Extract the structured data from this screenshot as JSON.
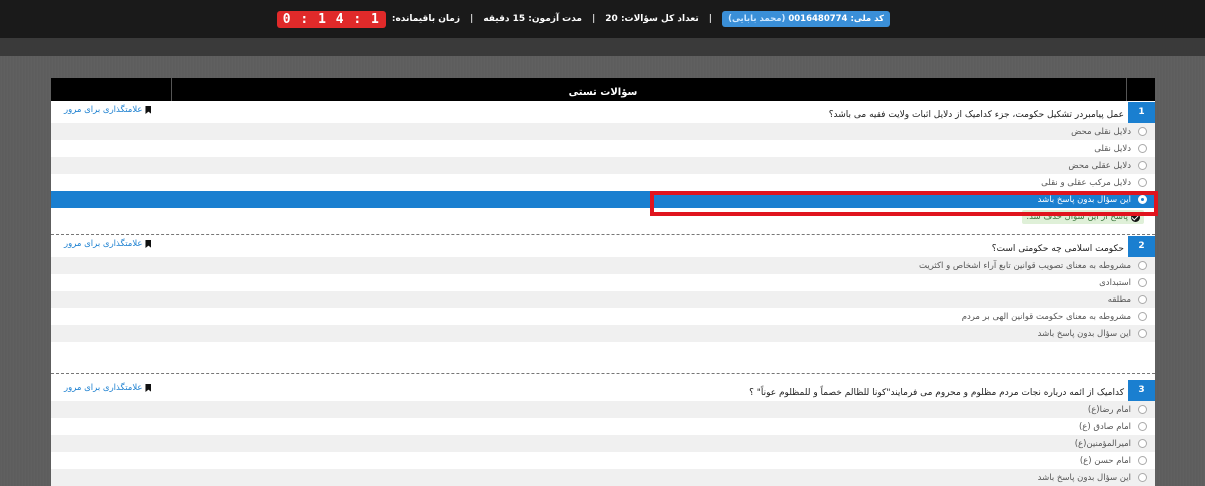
{
  "topbar": {
    "id_badge_prefix": "کد ملی: 0016480774",
    "id_badge_name": "(محمد بابایی)",
    "total_questions": "تعداد کل سؤالات: 20",
    "duration": "مدت آزمون: 15 دقیقه",
    "remaining_label": "زمان باقیمانده:",
    "timer": "0 : 1 4 : 1",
    "separator": "|"
  },
  "panel": {
    "header_title": "سؤالات تستی",
    "bookmark_label": "علامتگذاری برای مرور"
  },
  "questions": [
    {
      "number": "1",
      "text": "عمل پیامبردر تشکیل حکومت، جزء کدامیک از دلایل اثبات ولایت فقیه می باشد؟",
      "options": [
        "دلایل نقلی محض",
        "دلایل نقلی",
        "دلایل عقلی محض",
        "دلایل مرکب عقلی و نقلی",
        "این سؤال بدون پاسخ باشد"
      ],
      "selected": 4,
      "message": "پاسخ از این سؤال حذف شد."
    },
    {
      "number": "2",
      "text": "حکومت اسلامی چه حکومتی است؟",
      "options": [
        "مشروطه به معنای تصویب قوانین تابع آراء اشخاص و اکثریت",
        "استبدادی",
        "مطلقه",
        "مشروطه به معنای حکومت قوانین الهی بر مردم",
        "این سؤال بدون پاسخ باشد"
      ],
      "selected": -1
    },
    {
      "number": "3",
      "text": "کدامیک از ائمه درباره نجات مردم مظلوم و محروم می فرمایند\"کونا للظالم خصماً و للمظلوم عوناً\" ؟",
      "options": [
        "امام رضا(ع)",
        "امام صادق (ع)",
        "امیرالمؤمنین(ع)",
        "امام حسن (ع)",
        "این سؤال بدون پاسخ باشد"
      ],
      "selected": -1
    }
  ],
  "colors": {
    "accent": "#1a7fd0",
    "timer_bg": "#e02a2a",
    "highlight_border": "#e0141e",
    "success_bg": "#dff0d8"
  }
}
